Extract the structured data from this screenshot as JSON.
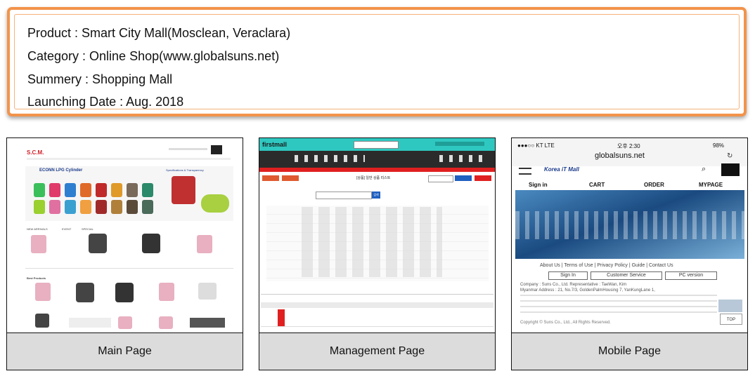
{
  "info": {
    "product": "Product : Smart City Mall(Mosclean, Veraclara)",
    "category": "Category : Online Shop(www.globalsuns.net)",
    "summary": "Summery : Shopping Mall",
    "launch": "Launching Date : Aug. 2018"
  },
  "panels": {
    "main": {
      "caption": "Main Page",
      "logo": "S.C.M.",
      "banner_title": "ECONN LPG Cylinder",
      "banner_sub": "Specifications & Transparency",
      "section_new": "NEW ARRIVALS",
      "section_event": "EVENT",
      "section_special": "SPECIAL",
      "section_best": "Best Products"
    },
    "management": {
      "caption": "Management Page",
      "logo": "firstmall",
      "title": "[상품] 일반 상품 리스트",
      "search_btn": "검색"
    },
    "mobile": {
      "caption": "Mobile Page",
      "carrier": "●●●○○ KT  LTE",
      "time": "오후 2:30",
      "battery": "98%",
      "url": "globalsuns.net",
      "brand": "Korea iT Mall",
      "nav": [
        "Sign in",
        "CART",
        "ORDER",
        "MYPAGE"
      ],
      "footer_links": "About Us | Terms of Use | Privacy Policy | Guide | Contact Us",
      "btn_signin": "Sign In",
      "btn_service": "Customer Service",
      "btn_pc": "PC version",
      "company_line": "Company : Suns Co., Ltd.   Representative : TaeWan, Kim",
      "address_line": "Myanmar Address : 21, No.7/3, GoldenPalmHousing 7, YanKungLane 1,",
      "top": "TOP",
      "copyright": "Copyright © Suns Co., Ltd., All Rights Reserved."
    }
  },
  "colors": {
    "accent_orange": "#f2934a",
    "caption_bg": "#dcdcdc",
    "mgmt_header": "#2ec8c0",
    "mgmt_dark": "#2b2b2b",
    "mgmt_red": "#e02020",
    "mobile_blue": "#1a3a8a"
  }
}
